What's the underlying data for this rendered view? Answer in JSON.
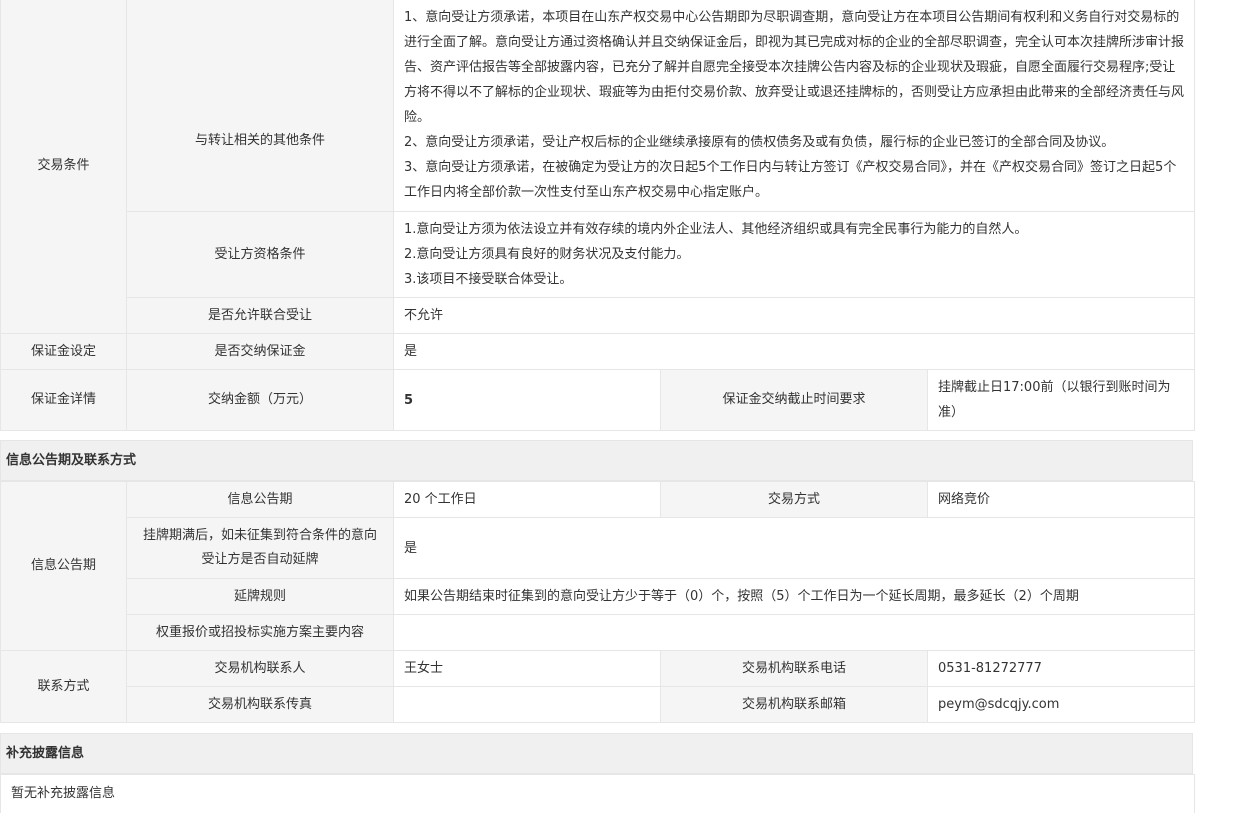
{
  "conditions": {
    "trade_label": "交易条件",
    "other_label": "与转让相关的其他条件",
    "other_items": [
      "1、意向受让方须承诺，本项目在山东产权交易中心公告期即为尽职调查期，意向受让方在本项目公告期间有权利和义务自行对交易标的进行全面了解。意向受让方通过资格确认并且交纳保证金后，即视为其已完成对标的企业的全部尽职调查，完全认可本次挂牌所涉审计报告、资产评估报告等全部披露内容，已充分了解并自愿完全接受本次挂牌公告内容及标的企业现状及瑕疵，自愿全面履行交易程序;受让方将不得以不了解标的企业现状、瑕疵等为由拒付交易价款、放弃受让或退还挂牌标的，否则受让方应承担由此带来的全部经济责任与风险。",
      "2、意向受让方须承诺，受让产权后标的企业继续承接原有的债权债务及或有负债，履行标的企业已签订的全部合同及协议。",
      "3、意向受让方须承诺，在被确定为受让方的次日起5个工作日内与转让方签订《产权交易合同》，并在《产权交易合同》签订之日起5个工作日内将全部价款一次性支付至山东产权交易中心指定账户。"
    ],
    "qualification_label": "受让方资格条件",
    "qualification_items": [
      "1.意向受让方须为依法设立并有效存续的境内外企业法人、其他经济组织或具有完全民事行为能力的自然人。",
      "2.意向受让方须具有良好的财务状况及支付能力。",
      "3.该项目不接受联合体受让。"
    ],
    "joint_label": "是否允许联合受让",
    "joint_value": "不允许"
  },
  "deposit": {
    "setting_label": "保证金设定",
    "pay_label": "是否交纳保证金",
    "pay_value": "是",
    "detail_label": "保证金详情",
    "amount_label": "交纳金额（万元）",
    "amount_value": "5",
    "deadline_label": "保证金交纳截止时间要求",
    "deadline_value": "挂牌截止日17:00前（以银行到账时间为准）"
  },
  "announcement": {
    "section_title": "信息公告期及联系方式",
    "period_group": "信息公告期",
    "period_label": "信息公告期",
    "period_value": "20 个工作日",
    "method_label": "交易方式",
    "method_value": "网络竞价",
    "auto_extend_label": "挂牌期满后，如未征集到符合条件的意向受让方是否自动延牌",
    "auto_extend_value": "是",
    "extend_rule_label": "延牌规则",
    "extend_rule_value": "如果公告期结束时征集到的意向受让方少于等于（0）个，按照（5）个工作日为一个延长周期，最多延长（2）个周期",
    "weight_label": "权重报价或招投标实施方案主要内容",
    "weight_value": ""
  },
  "contact": {
    "group": "联系方式",
    "person_label": "交易机构联系人",
    "person_value": "王女士",
    "phone_label": "交易机构联系电话",
    "phone_value": "0531-81272777",
    "fax_label": "交易机构联系传真",
    "fax_value": "",
    "email_label": "交易机构联系邮箱",
    "email_value": "peym@sdcqjy.com"
  },
  "supplement": {
    "section_title": "补充披露信息",
    "empty_text": "暂无补充披露信息"
  }
}
